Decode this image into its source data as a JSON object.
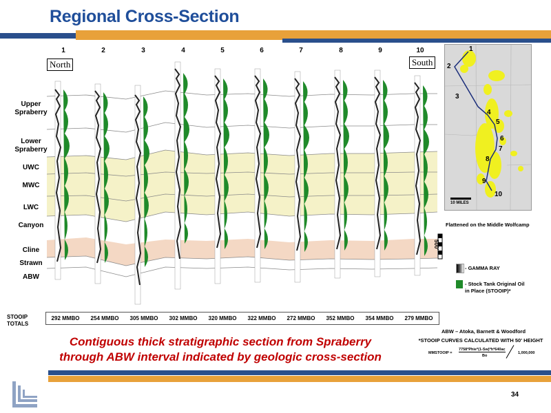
{
  "slide": {
    "title": "Regional Cross-Section",
    "page_number": "34"
  },
  "cross_section": {
    "well_numbers": [
      "1",
      "2",
      "3",
      "4",
      "5",
      "6",
      "7",
      "8",
      "9",
      "10"
    ],
    "north_label": "North",
    "south_label": "South",
    "zones": [
      "Upper Spraberry",
      "Lower Spraberry",
      "UWC",
      "MWC",
      "LWC",
      "Canyon",
      "Cline",
      "Strawn",
      "ABW"
    ],
    "scale_label": "500'",
    "stooip_label": "STOOIP TOTALS",
    "stooip_values": [
      "292 MMBO",
      "254 MMBO",
      "305 MMBO",
      "302 MMBO",
      "320 MMBO",
      "322 MMBO",
      "272 MMBO",
      "352 MMBO",
      "354 MMBO",
      "279 MMBO"
    ]
  },
  "map": {
    "well_labels": [
      "1",
      "2",
      "3",
      "4",
      "5",
      "6",
      "7",
      "8",
      "9",
      "10"
    ],
    "scale_label": "10 MILES",
    "note": "Flattened on the Middle Wolfcamp"
  },
  "legend": {
    "gamma_ray": "- GAMMA RAY",
    "stooip": "- Stock Tank Original Oil in Place (STOOIP)*"
  },
  "footnotes": {
    "abw": "ABW – Atoka, Barnett & Woodford",
    "stooip_note": "*STOOIP CURVES CALCULATED WITH 50' HEIGHT",
    "formula_prefix": "MMSTOOIP =",
    "formula_numerator": "7758*Phie*(1-Sw)*h*640ac",
    "formula_denominator": "Bo",
    "formula_divisor": "1,000,000"
  },
  "caption": {
    "line1": "Contiguous thick stratigraphic section from Spraberry",
    "line2": "through ABW interval indicated by geologic cross-section"
  },
  "colors": {
    "title": "#1f4e9a",
    "header_bar_blue": "#2a4f8c",
    "header_bar_orange": "#e8a13a",
    "wolfcamp_band": "#f5f2c8",
    "cline_band": "#f4d8c4",
    "stooip_green": "#1f8a2a",
    "caption": "#c00000",
    "map_wells": "#f0f020"
  }
}
